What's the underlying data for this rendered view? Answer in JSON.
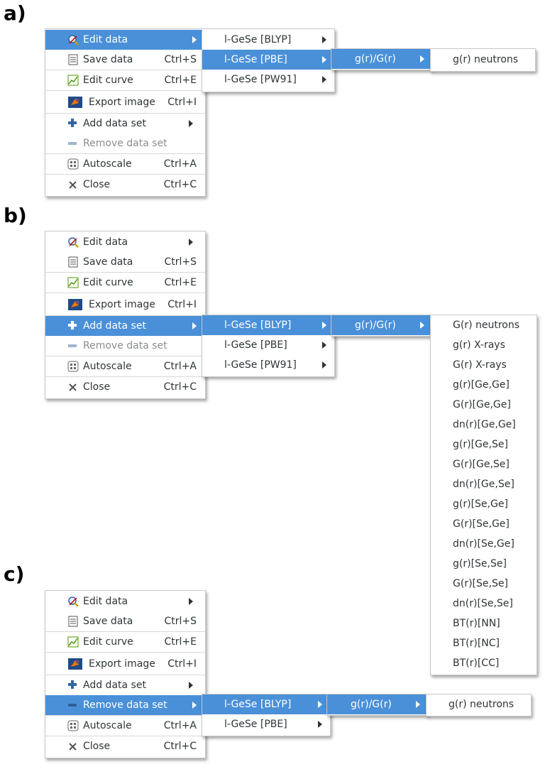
{
  "panels": {
    "a": "a)",
    "b": "b)",
    "c": "c)"
  },
  "menu": {
    "edit_data": "Edit data",
    "save_data": "Save data",
    "save_shortcut": "Ctrl+S",
    "edit_curve": "Edit curve",
    "edit_curve_shortcut": "Ctrl+E",
    "export_image": "Export image",
    "export_shortcut": "Ctrl+I",
    "add_data_set": "Add data set",
    "remove_data_set": "Remove data set",
    "autoscale": "Autoscale",
    "autoscale_shortcut": "Ctrl+A",
    "close": "Close",
    "close_shortcut": "Ctrl+C"
  },
  "datasets": {
    "blyp": "l-GeSe [BLYP]",
    "pbe": "l-GeSe [PBE]",
    "pw91": "l-GeSe [PW91]"
  },
  "submenu": {
    "gr": "g(r)/G(r)"
  },
  "a_curves": [
    "g(r) neutrons"
  ],
  "b_curves": [
    "G(r) neutrons",
    "g(r) X-rays",
    "G(r) X-rays",
    "g(r)[Ge,Ge]",
    "G(r)[Ge,Ge]",
    "dn(r)[Ge,Ge]",
    "g(r)[Ge,Se]",
    "G(r)[Ge,Se]",
    "dn(r)[Ge,Se]",
    "g(r)[Se,Ge]",
    "G(r)[Se,Ge]",
    "dn(r)[Se,Ge]",
    "g(r)[Se,Se]",
    "G(r)[Se,Se]",
    "dn(r)[Se,Se]",
    "BT(r)[NN]",
    "BT(r)[NC]",
    "BT(r)[CC]"
  ],
  "c_curves": [
    "g(r) neutrons"
  ],
  "colors": {
    "highlight": "#4a90d9",
    "text": "#2e3436",
    "disabled": "#8a8e8e"
  }
}
